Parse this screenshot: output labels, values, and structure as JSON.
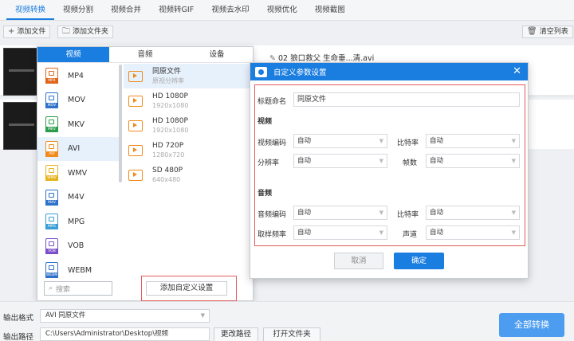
{
  "tabs": [
    "视频转换",
    "视频分割",
    "视频合并",
    "视频转GIF",
    "视频去水印",
    "视频优化",
    "视频截图"
  ],
  "toolbar": {
    "add_file": "添加文件",
    "add_folder": "添加文件夹",
    "clear_list": "清空列表"
  },
  "file": {
    "name": "02 狼口救父 生命垂...清.avi"
  },
  "format_panel": {
    "tabs": [
      "视频",
      "音频",
      "设备"
    ],
    "formats": [
      {
        "label": "MP4",
        "color": "#e0641b"
      },
      {
        "label": "MOV",
        "color": "#2f72c9"
      },
      {
        "label": "MKV",
        "color": "#2c9c4b"
      },
      {
        "label": "AVI",
        "color": "#f08a1c"
      },
      {
        "label": "WMV",
        "color": "#e6b31e"
      },
      {
        "label": "M4V",
        "color": "#2f72c9"
      },
      {
        "label": "MPG",
        "color": "#3a9fd6"
      },
      {
        "label": "VOB",
        "color": "#7b4fc9"
      },
      {
        "label": "WEBM",
        "color": "#2f72c9"
      }
    ],
    "qualities": [
      {
        "name": "同原文件",
        "sub": "原视分辨率"
      },
      {
        "name": "HD 1080P",
        "sub": "1920x1080"
      },
      {
        "name": "HD 1080P",
        "sub": "1920x1080"
      },
      {
        "name": "HD 720P",
        "sub": "1280x720"
      },
      {
        "name": "SD 480P",
        "sub": "640x480"
      }
    ],
    "search_placeholder": "搜索",
    "add_custom": "添加自定义设置"
  },
  "dialog": {
    "title": "自定义参数设置",
    "name_label": "标题命名",
    "name_value": "同原文件",
    "video_section": "视频",
    "audio_section": "音频",
    "video_encoder": "视频编码",
    "bitrate": "比特率",
    "resolution": "分辨率",
    "framerate": "帧数",
    "audio_encoder": "音频编码",
    "audio_bitrate": "比特率",
    "samplerate": "取样频率",
    "channels": "声道",
    "auto": "自动",
    "cancel": "取消",
    "ok": "确定"
  },
  "bottom": {
    "output_format_label": "输出格式",
    "output_format_value": "AVI  同原文件",
    "output_path_label": "输出路径",
    "output_path_value": "C:\\Users\\Administrator\\Desktop\\视频",
    "change_path": "更改路径",
    "open_folder": "打开文件夹",
    "convert_all": "全部转换"
  }
}
